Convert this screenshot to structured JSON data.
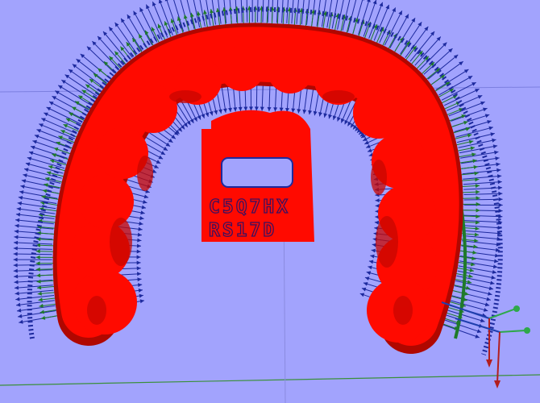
{
  "viewport": {
    "background_color": "#a2a3fd"
  },
  "model": {
    "color": "#ff0a00",
    "engraved_id": {
      "line1": "C5Q7HX",
      "line2": "RS17D"
    }
  },
  "normals": {
    "outer_color": "#1d2a9e",
    "mid_color": "#1f7a2a",
    "inner_color": "#7a2a50"
  },
  "axis_gizmo": {
    "icons": [
      "axis-triad-icon",
      "axis-triad-icon"
    ],
    "colors": [
      "#2ea84a",
      "#1f3fae",
      "#b21e1e"
    ]
  },
  "grid": {
    "horizon_color": "#3a8f3a"
  }
}
